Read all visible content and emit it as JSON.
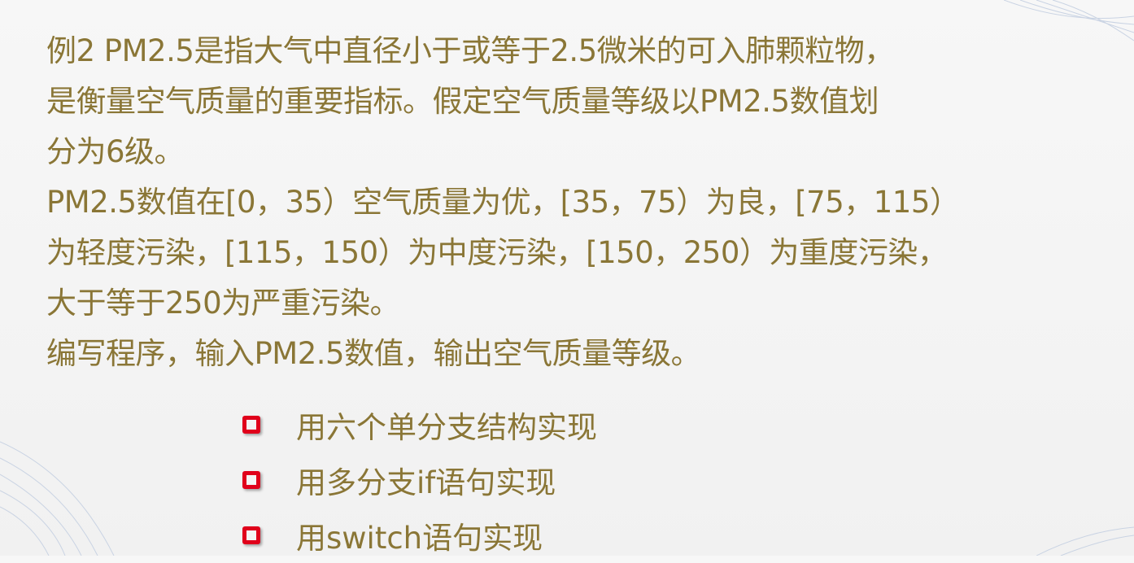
{
  "paragraph": [
    "例2  PM2.5是指大气中直径小于或等于2.5微米的可入肺颗粒物，",
    "是衡量空气质量的重要指标。假定空气质量等级以PM2.5数值划",
    "分为6级。",
    "PM2.5数值在[0，35）空气质量为优，[35，75）为良，[75，115）",
    "为轻度污染，[115，150）为中度污染，[150，250）为重度污染，",
    "大于等于250为严重污染。",
    "编写程序，输入PM2.5数值，输出空气质量等级。"
  ],
  "bullets": [
    "用六个单分支结构实现",
    "用多分支if语句实现",
    "用switch语句实现"
  ],
  "colors": {
    "text": "#8a7636",
    "bullet": "#e0001b"
  }
}
